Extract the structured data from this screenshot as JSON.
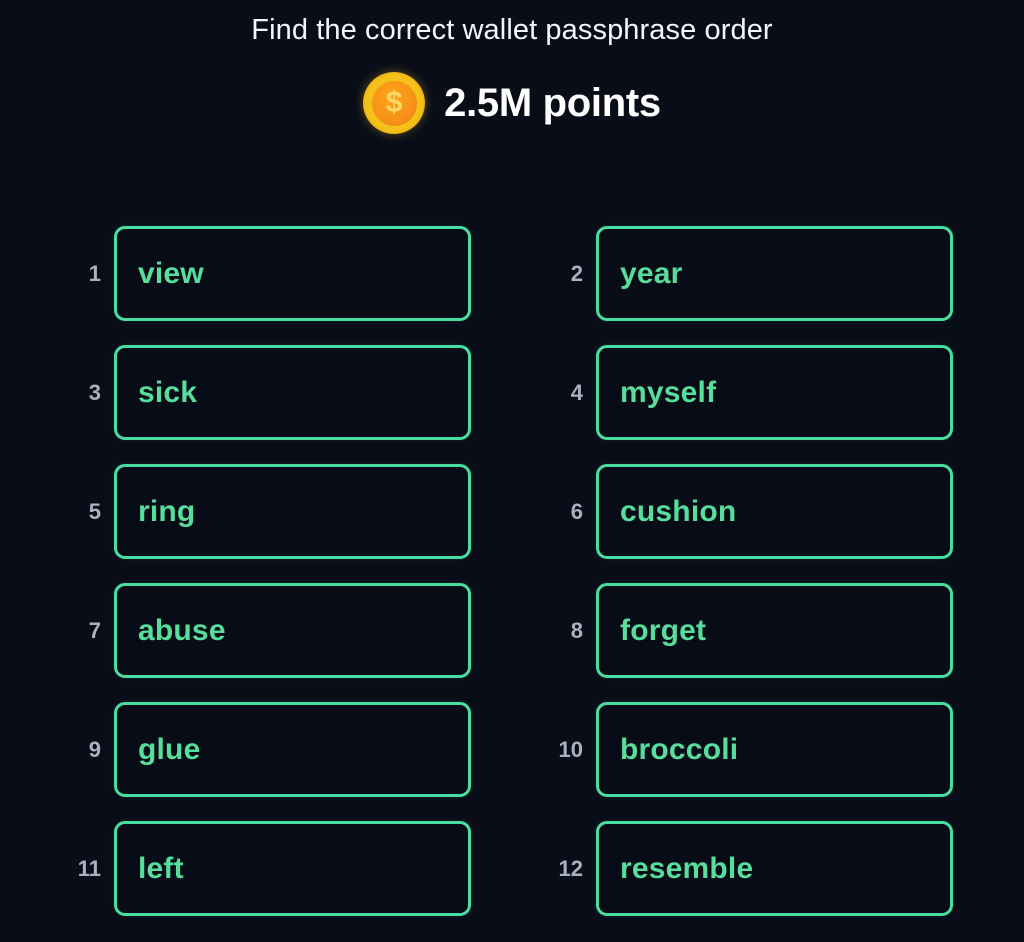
{
  "page": {
    "background_color": "#090d18",
    "title": "Find the correct wallet passphrase order"
  },
  "header": {
    "title": "Find the correct wallet passphrase order",
    "reward": {
      "coin_icon": "coin-dollar-icon",
      "coin_symbol": "$",
      "coin_color": "#f7931a",
      "coin_rim_color": "#f3c218",
      "points_label": "2.5M points",
      "points_color": "#ffffff"
    }
  },
  "word_grid": {
    "accent_color": "#4bdca0",
    "word_text_color": "#57dd9c",
    "index_color": "#a9b2c0",
    "columns": 2,
    "total_words": 12,
    "rows": [
      {
        "left": {
          "index": "1",
          "word": "view"
        },
        "right": {
          "index": "2",
          "word": "year"
        }
      },
      {
        "left": {
          "index": "3",
          "word": "sick"
        },
        "right": {
          "index": "4",
          "word": "myself"
        }
      },
      {
        "left": {
          "index": "5",
          "word": "ring"
        },
        "right": {
          "index": "6",
          "word": "cushion"
        }
      },
      {
        "left": {
          "index": "7",
          "word": "abuse"
        },
        "right": {
          "index": "8",
          "word": "forget"
        }
      },
      {
        "left": {
          "index": "9",
          "word": "glue"
        },
        "right": {
          "index": "10",
          "word": "broccoli"
        }
      },
      {
        "left": {
          "index": "11",
          "word": "left"
        },
        "right": {
          "index": "12",
          "word": "resemble"
        }
      }
    ]
  }
}
